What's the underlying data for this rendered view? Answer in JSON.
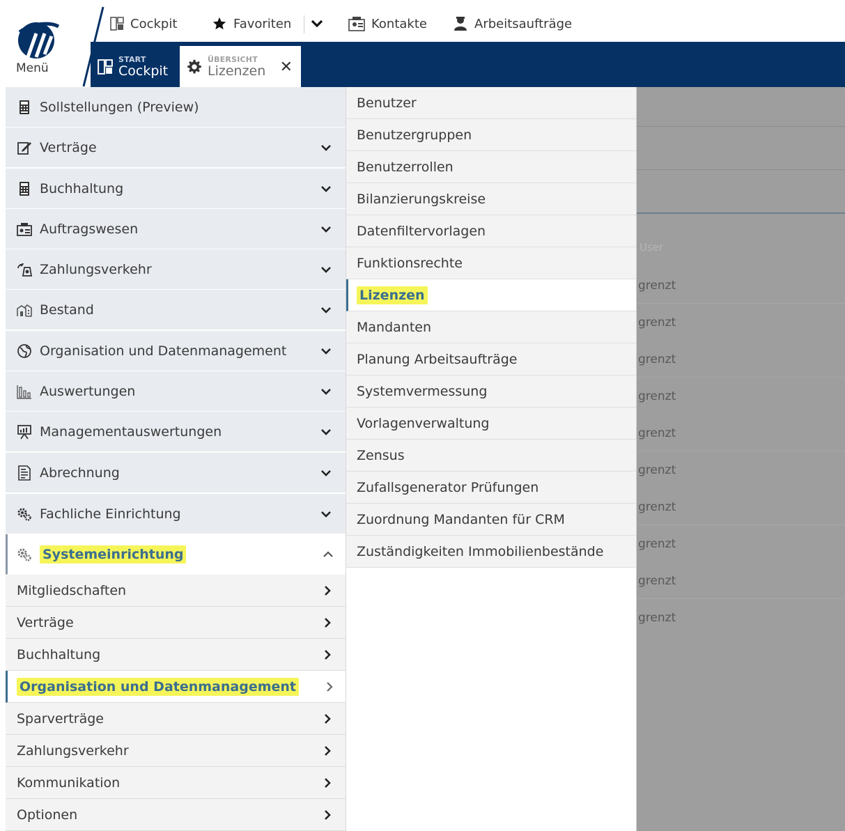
{
  "logo": {
    "menu_label": "Menü"
  },
  "topbar": {
    "items": [
      {
        "label": "Cockpit",
        "icon": "dashboard-icon"
      },
      {
        "label": "Favoriten",
        "icon": "star-icon"
      },
      {
        "label": "Kontakte",
        "icon": "contacts-icon"
      },
      {
        "label": "Arbeitsaufträge",
        "icon": "worker-icon"
      }
    ]
  },
  "tabs": [
    {
      "small": "START",
      "big": "Cockpit"
    },
    {
      "small": "ÜBERSICHT",
      "big": "Lizenzen"
    }
  ],
  "left_menu": {
    "items": [
      {
        "label": "Sollstellungen (Preview)",
        "icon": "calculator-icon",
        "chevron": ""
      },
      {
        "label": "Verträge",
        "icon": "edit-contract-icon",
        "chevron": "down"
      },
      {
        "label": "Buchhaltung",
        "icon": "calculator-icon",
        "chevron": "down"
      },
      {
        "label": "Auftragswesen",
        "icon": "orders-icon",
        "chevron": "down"
      },
      {
        "label": "Zahlungsverkehr",
        "icon": "payment-icon",
        "chevron": "down"
      },
      {
        "label": "Bestand",
        "icon": "buildings-icon",
        "chevron": "down"
      },
      {
        "label": "Organisation und Datenmanagement",
        "icon": "globe-icon",
        "chevron": "down"
      },
      {
        "label": "Auswertungen",
        "icon": "bar-chart-icon",
        "chevron": "down"
      },
      {
        "label": "Managementauswertungen",
        "icon": "presentation-icon",
        "chevron": "down"
      },
      {
        "label": "Abrechnung",
        "icon": "invoice-icon",
        "chevron": "down"
      },
      {
        "label": "Fachliche Einrichtung",
        "icon": "gears-icon",
        "chevron": "down"
      },
      {
        "label": "Systemeinrichtung",
        "icon": "gears-icon",
        "chevron": "up"
      }
    ],
    "sub_items": [
      {
        "label": "Mitgliedschaften"
      },
      {
        "label": "Verträge"
      },
      {
        "label": "Buchhaltung"
      },
      {
        "label": "Organisation und Datenmanagement"
      },
      {
        "label": "Sparverträge"
      },
      {
        "label": "Zahlungsverkehr"
      },
      {
        "label": "Kommunikation"
      },
      {
        "label": "Optionen"
      }
    ]
  },
  "mid_menu": {
    "items": [
      {
        "label": "Benutzer"
      },
      {
        "label": "Benutzergruppen"
      },
      {
        "label": "Benutzerrollen"
      },
      {
        "label": "Bilanzierungskreise"
      },
      {
        "label": "Datenfiltervorlagen"
      },
      {
        "label": "Funktionsrechte"
      },
      {
        "label": "Lizenzen"
      },
      {
        "label": "Mandanten"
      },
      {
        "label": "Planung Arbeitsaufträge"
      },
      {
        "label": "Systemvermessung"
      },
      {
        "label": "Vorlagenverwaltung"
      },
      {
        "label": "Zensus"
      },
      {
        "label": "Zufallsgenerator Prüfungen"
      },
      {
        "label": "Zuordnung Mandanten für CRM"
      },
      {
        "label": "Zuständigkeiten Immobilienbestände"
      }
    ]
  },
  "background_table": {
    "header": "User",
    "cells": [
      "grenzt",
      "grenzt",
      "grenzt",
      "grenzt",
      "grenzt",
      "grenzt",
      "grenzt",
      "grenzt",
      "grenzt",
      "grenzt"
    ]
  },
  "colors": {
    "navy": "#063165",
    "highlight": "#f5f55a",
    "active_text": "#3b6e8f",
    "menu_bg": "#e8ebf0"
  }
}
